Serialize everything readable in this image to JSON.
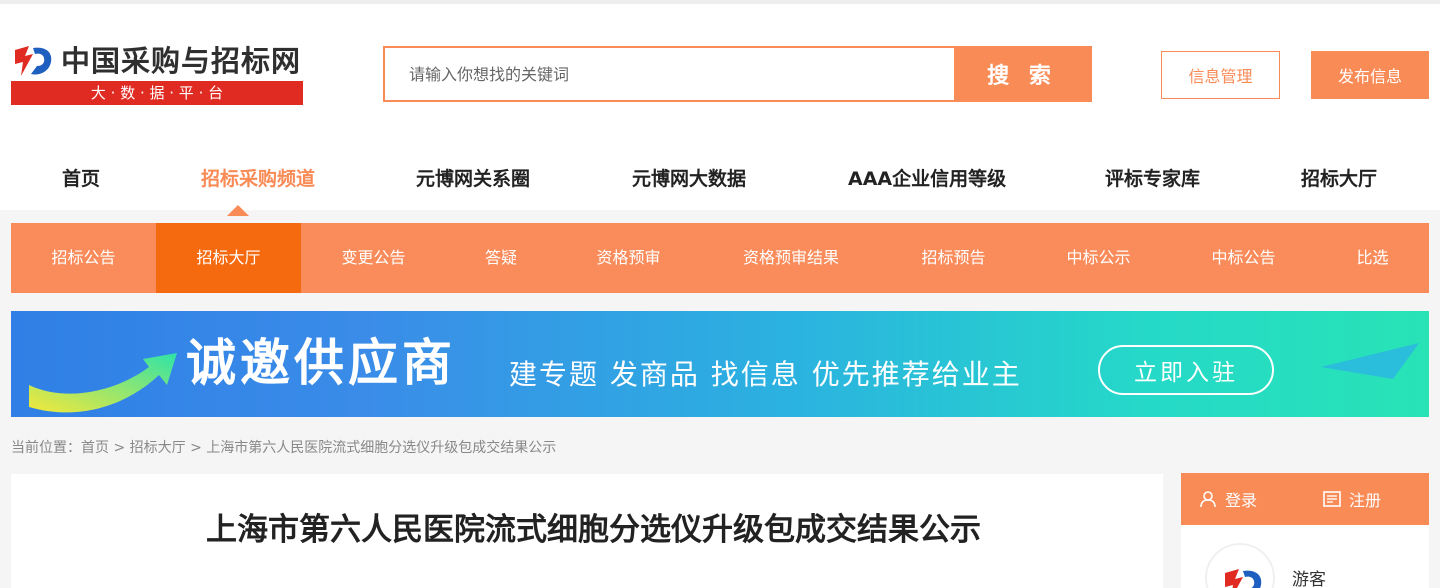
{
  "header": {
    "logo_title": "中国采购与招标网",
    "logo_subtitle": "大 · 数 · 据 · 平 · 台",
    "search_placeholder": "请输入你想找的关键词",
    "search_button": "搜 索",
    "manage_button": "信息管理",
    "publish_button": "发布信息"
  },
  "main_nav": [
    {
      "label": "首页"
    },
    {
      "label": "招标采购频道"
    },
    {
      "label": "元博网关系圈"
    },
    {
      "label": "元博网大数据"
    },
    {
      "label": "AAA企业信用等级"
    },
    {
      "label": "评标专家库"
    },
    {
      "label": "招标大厅"
    }
  ],
  "sub_nav": [
    {
      "label": "招标公告"
    },
    {
      "label": "招标大厅"
    },
    {
      "label": "变更公告"
    },
    {
      "label": "答疑"
    },
    {
      "label": "资格预审"
    },
    {
      "label": "资格预审结果"
    },
    {
      "label": "招标预告"
    },
    {
      "label": "中标公示"
    },
    {
      "label": "中标公告"
    },
    {
      "label": "比选"
    }
  ],
  "banner": {
    "title": "诚邀供应商",
    "subtitle": "建专题 发商品 找信息 优先推荐给业主",
    "button": "立即入驻"
  },
  "breadcrumb": {
    "prefix": "当前位置：",
    "home": "首页",
    "sep1": " > ",
    "section": "招标大厅",
    "sep2": " > ",
    "current": "上海市第六人民医院流式细胞分选仪升级包成交结果公示"
  },
  "article": {
    "title": "上海市第六人民医院流式细胞分选仪升级包成交结果公示"
  },
  "side": {
    "login": "登录",
    "register": "注册",
    "guest": "游客"
  },
  "colors": {
    "accent": "#f98b57",
    "active_tab": "#f56a0e",
    "logo_red": "#e02b22"
  }
}
